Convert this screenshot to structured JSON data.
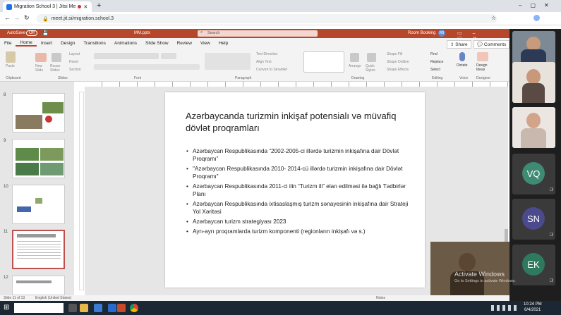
{
  "browser": {
    "tab_title": "Migration School 3 | Jitsi Me",
    "url": "meet.jit.si/migration.school.3",
    "new_tab": "+"
  },
  "ppt": {
    "autosave": "AutoSave",
    "autosave_state": "Off",
    "filename": "MM.pptx",
    "search_placeholder": "Search",
    "user": "Room Booking",
    "initials": "RB"
  },
  "menu": [
    "File",
    "Home",
    "Insert",
    "Design",
    "Transitions",
    "Animations",
    "Slide Show",
    "Review",
    "View",
    "Help"
  ],
  "share_label": "Share",
  "comments_label": "Comments",
  "ribbon": {
    "groups": [
      "Clipboard",
      "Slides",
      "Font",
      "Paragraph",
      "Drawing",
      "Editing",
      "Voice",
      "Designer"
    ],
    "paste": "Paste",
    "new_slide": "New Slide",
    "reuse_slides": "Reuse Slides",
    "layout": "Layout",
    "reset": "Reset",
    "section": "Section",
    "text_direction": "Text Direction",
    "align_text": "Align Text",
    "convert_smartart": "Convert to SmartArt",
    "arrange": "Arrange",
    "quick_styles": "Quick Styles",
    "shape_fill": "Shape Fill",
    "shape_outline": "Shape Outline",
    "shape_effects": "Shape Effects",
    "find": "Find",
    "replace": "Replace",
    "select": "Select",
    "dictate": "Dictate",
    "design_ideas": "Design Ideas"
  },
  "thumbs": [
    {
      "num": "8"
    },
    {
      "num": "9"
    },
    {
      "num": "10"
    },
    {
      "num": "11"
    },
    {
      "num": "12"
    }
  ],
  "slide": {
    "title": "Azərbaycanda turizmin inkişaf potensialı və müvafiq dövlət proqramları",
    "bullets": [
      "Azərbaycan Respublikasında “2002-2005-ci illərdə turizmin inkişafına dair Dövlət Proqramı”",
      "\"Azərbaycan Respublikasında 2010- 2014-cü illərdə turizmin inkişafına dair Dövlət Proqramı\"",
      "Azərbaycan Respublikasında 2011-ci ilin “Turizm ili” elan edilməsi ilə bağlı Tədbirlər Planı",
      " Azərbaycan Respublikasında ixtisaslaşmış turizm sənayesinin inkişafına dair Strateji Yol Xəritəsi",
      "Azərbaycan turizm strategiyası 2023",
      "Ayrı-ayrı proqramlarda turizm komponenti (regionların inkişafı və s.)"
    ]
  },
  "status": {
    "slide": "Slide 11 of 13",
    "language": "English (United States)",
    "notes": "Notes"
  },
  "participants": [
    {
      "initials": "VQ",
      "color": "#3f8a72"
    },
    {
      "initials": "SN",
      "color": "#4b4a8c"
    },
    {
      "initials": "EK",
      "color": "#2f7a5e"
    }
  ],
  "watermark": {
    "line1": "Activate Windows",
    "line2": "Go to Settings to activate Windows."
  },
  "clock": {
    "time": "10:24 PM",
    "date": "6/4/2021"
  }
}
